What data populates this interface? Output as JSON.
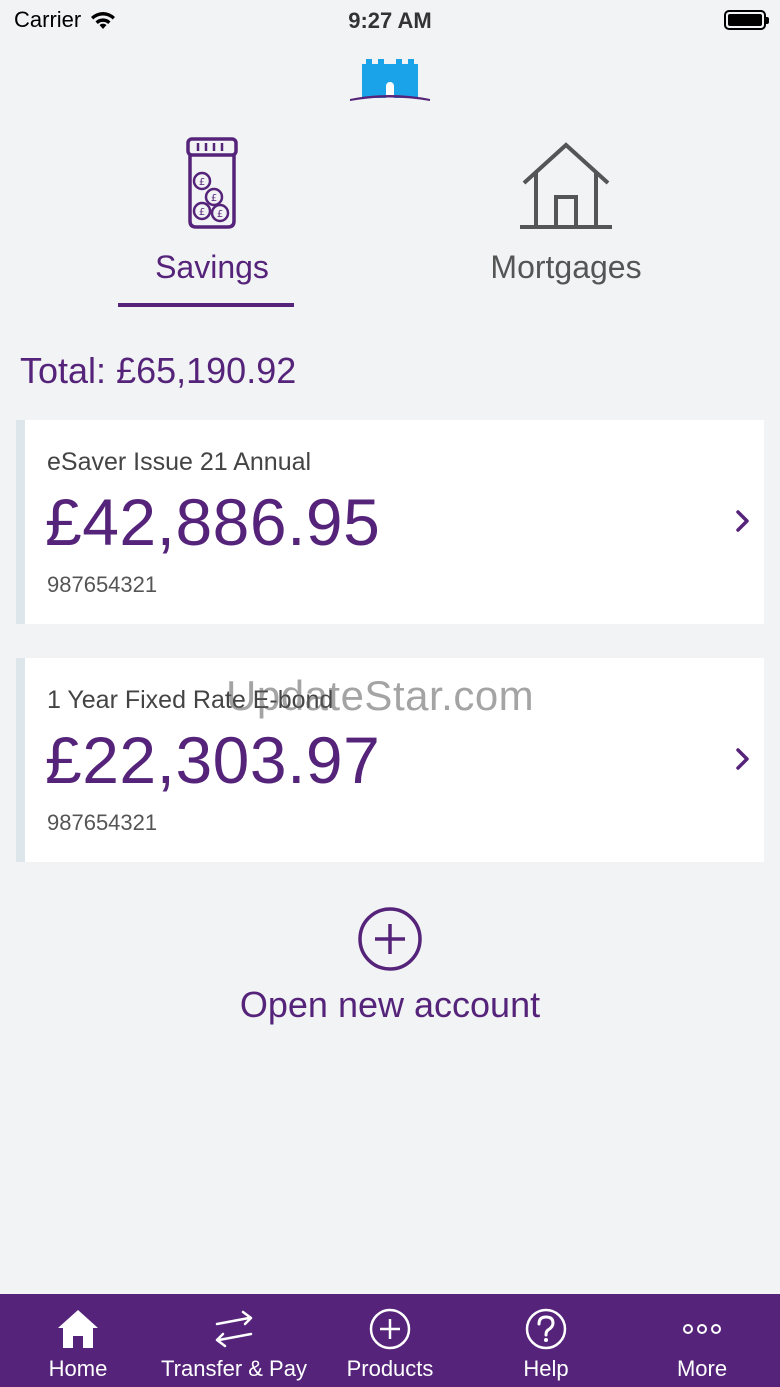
{
  "status_bar": {
    "carrier": "Carrier",
    "time": "9:27 AM"
  },
  "colors": {
    "brand_purple": "#55247a",
    "logo_blue": "#1aa3e8",
    "card_accent": "#dde6ea",
    "background": "#f2f3f5"
  },
  "tabs": [
    {
      "label": "Savings",
      "icon": "coin-jar-icon",
      "selected": true
    },
    {
      "label": "Mortgages",
      "icon": "house-icon",
      "selected": false
    }
  ],
  "total": {
    "label": "Total:",
    "amount": "£65,190.92"
  },
  "accounts": [
    {
      "name": "eSaver Issue 21 Annual",
      "balance": "£42,886.95",
      "number": "987654321"
    },
    {
      "name": "1 Year Fixed Rate E-bond",
      "balance": "£22,303.97",
      "number": "987654321"
    }
  ],
  "watermark": "UpdateStar.com",
  "open_account": {
    "label": "Open new account",
    "icon": "plus-circle-icon"
  },
  "bottom_nav": [
    {
      "label": "Home",
      "icon": "home-icon"
    },
    {
      "label": "Transfer & Pay",
      "icon": "transfer-arrows-icon"
    },
    {
      "label": "Products",
      "icon": "plus-circle-icon"
    },
    {
      "label": "Help",
      "icon": "help-circle-icon"
    },
    {
      "label": "More",
      "icon": "more-dots-icon"
    }
  ]
}
